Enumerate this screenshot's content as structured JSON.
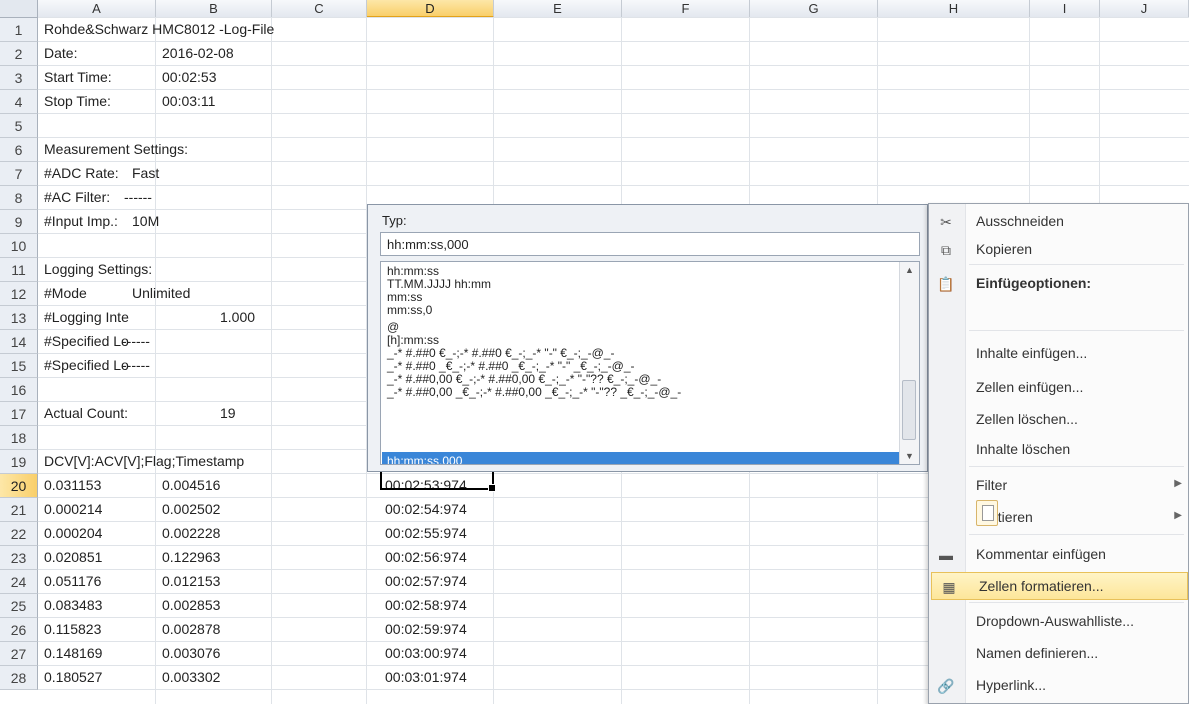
{
  "columns": [
    "A",
    "B",
    "C",
    "D",
    "E",
    "F",
    "G",
    "H",
    "I",
    "J"
  ],
  "selected_column": "D",
  "rows": [
    {
      "n": "1",
      "a": "Rohde&Schwarz HMC8012 -Log-File",
      "b": "",
      "c": "",
      "d": ""
    },
    {
      "n": "2",
      "a": "Date:",
      "b": "2016-02-08",
      "c": "",
      "d": ""
    },
    {
      "n": "3",
      "a": "Start Time:",
      "b": "00:02:53",
      "c": "",
      "d": ""
    },
    {
      "n": "4",
      "a": "Stop Time:",
      "b": "00:03:11",
      "c": "",
      "d": ""
    },
    {
      "n": "5",
      "a": "",
      "b": "",
      "c": "",
      "d": ""
    },
    {
      "n": "6",
      "a": "Measurement Settings:",
      "b": "",
      "c": "",
      "d": ""
    },
    {
      "n": "7",
      "a": "#ADC Rate:",
      "b": "Fast",
      "c": "",
      "d": ""
    },
    {
      "n": "8",
      "a": "#AC Filter:",
      "b": "------",
      "c": "",
      "d": ""
    },
    {
      "n": "9",
      "a": "#Input Imp.:",
      "b": "10M",
      "c": "",
      "d": ""
    },
    {
      "n": "10",
      "a": "",
      "b": "",
      "c": "",
      "d": ""
    },
    {
      "n": "11",
      "a": "Logging Settings:",
      "b": "",
      "c": "",
      "d": ""
    },
    {
      "n": "12",
      "a": "#Mode",
      "b": "Unlimited",
      "c": "",
      "d": ""
    },
    {
      "n": "13",
      "a": "#Logging Inte",
      "b": "1.000",
      "c": "",
      "d": ""
    },
    {
      "n": "14",
      "a": "#Specified Lo",
      "b": "------",
      "c": "",
      "d": ""
    },
    {
      "n": "15",
      "a": "#Specified Lo",
      "b": "------",
      "c": "",
      "d": ""
    },
    {
      "n": "16",
      "a": "",
      "b": "",
      "c": "",
      "d": ""
    },
    {
      "n": "17",
      "a": "Actual Count:",
      "b": "19",
      "c": "",
      "d": ""
    },
    {
      "n": "18",
      "a": "",
      "b": "",
      "c": "",
      "d": ""
    },
    {
      "n": "19",
      "a": "DCV[V]:ACV[V];Flag;Timestamp",
      "b": "",
      "c": "",
      "d": ""
    },
    {
      "n": "20",
      "a": "0.031153",
      "b": "0.004516",
      "c": "",
      "d": "00:02:53:974"
    },
    {
      "n": "21",
      "a": "0.000214",
      "b": "0.002502",
      "c": "",
      "d": "00:02:54:974"
    },
    {
      "n": "22",
      "a": "0.000204",
      "b": "0.002228",
      "c": "",
      "d": "00:02:55:974"
    },
    {
      "n": "23",
      "a": "0.020851",
      "b": "0.122963",
      "c": "",
      "d": "00:02:56:974"
    },
    {
      "n": "24",
      "a": "0.051176",
      "b": "0.012153",
      "c": "",
      "d": "00:02:57:974"
    },
    {
      "n": "25",
      "a": "0.083483",
      "b": "0.002853",
      "c": "",
      "d": "00:02:58:974"
    },
    {
      "n": "26",
      "a": "0.115823",
      "b": "0.002878",
      "c": "",
      "d": "00:02:59:974"
    },
    {
      "n": "27",
      "a": "0.148169",
      "b": "0.003076",
      "c": "",
      "d": "00:03:00:974"
    },
    {
      "n": "28",
      "a": "0.180527",
      "b": "0.003302",
      "c": "",
      "d": "00:03:01:974"
    }
  ],
  "selected_row": "20",
  "format_dialog": {
    "type_label": "Typ:",
    "type_value": "hh:mm:ss,000",
    "list_items": [
      "hh:mm:ss",
      "TT.MM.JJJJ hh:mm",
      "mm:ss",
      "mm:ss,0",
      "@",
      "[h]:mm:ss",
      "_-* #.##0 €_-;-* #.##0 €_-;_-* \"-\" €_-;_-@_-",
      "_-* #.##0 _€_-;-* #.##0 _€_-;_-* \"-\" _€_-;_-@_-",
      "_-* #.##0,00 €_-;-* #.##0,00 €_-;_-* \"-\"?? €_-;_-@_-",
      "_-* #.##0,00 _€_-;-* #.##0,00 _€_-;_-* \"-\"?? _€_-;_-@_-"
    ],
    "selected_item": "hh:mm:ss,000"
  },
  "context_menu": {
    "items": [
      {
        "label": "Ausschneiden",
        "icon": "scissors-icon",
        "glyph": "✂"
      },
      {
        "label": "Kopieren",
        "icon": "copy-icon",
        "glyph": "⧉"
      },
      {
        "label": "Einfügeoptionen:",
        "icon": "paste-options-icon",
        "glyph": "📋"
      },
      {
        "label": "Inhalte einfügen...",
        "icon": "",
        "glyph": ""
      },
      {
        "label": "Zellen einfügen...",
        "icon": "",
        "glyph": ""
      },
      {
        "label": "Zellen löschen...",
        "icon": "",
        "glyph": ""
      },
      {
        "label": "Inhalte löschen",
        "icon": "",
        "glyph": ""
      },
      {
        "label": "Filter",
        "icon": "",
        "glyph": ""
      },
      {
        "label": "Sortieren",
        "icon": "",
        "glyph": ""
      },
      {
        "label": "Kommentar einfügen",
        "icon": "comment-icon",
        "glyph": "▬"
      },
      {
        "label": "Zellen formatieren...",
        "icon": "format-cells-icon",
        "glyph": "▦"
      },
      {
        "label": "Dropdown-Auswahlliste...",
        "icon": "",
        "glyph": ""
      },
      {
        "label": "Namen definieren...",
        "icon": "",
        "glyph": ""
      },
      {
        "label": "Hyperlink...",
        "icon": "hyperlink-icon",
        "glyph": "🔗"
      }
    ],
    "highlighted": "Zellen formatieren..."
  }
}
